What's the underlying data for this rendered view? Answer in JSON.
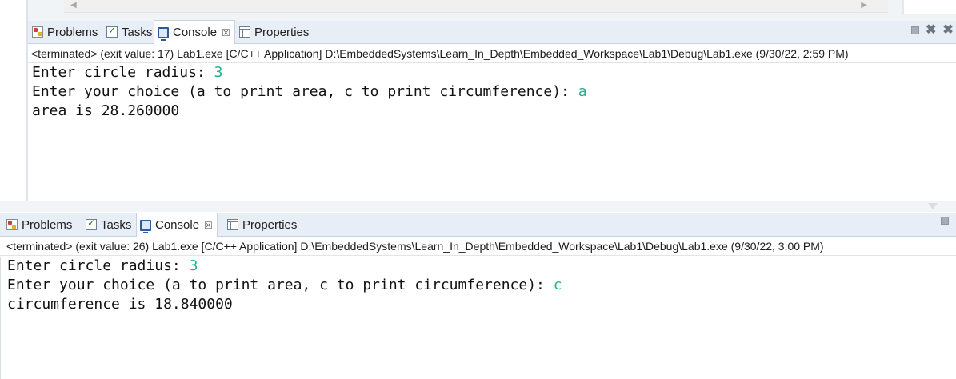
{
  "top_console": {
    "tabs": [
      {
        "label": "Problems",
        "icon": "problems-icon"
      },
      {
        "label": "Tasks",
        "icon": "tasks-icon"
      },
      {
        "label": "Console",
        "icon": "console-icon",
        "active": true
      },
      {
        "label": "Properties",
        "icon": "properties-icon"
      }
    ],
    "status": "<terminated> (exit value: 17) Lab1.exe [C/C++ Application] D:\\EmbeddedSystems\\Learn_In_Depth\\Embedded_Workspace\\Lab1\\Debug\\Lab1.exe (9/30/22, 2:59 PM)",
    "lines": [
      {
        "text": "Enter circle radius: ",
        "input": "3"
      },
      {
        "text": "Enter your choice (a to print area, c to print circumference): ",
        "input": "a"
      },
      {
        "text": "area is 28.260000",
        "input": ""
      }
    ]
  },
  "bottom_console": {
    "tabs": [
      {
        "label": "Problems",
        "icon": "problems-icon"
      },
      {
        "label": "Tasks",
        "icon": "tasks-icon"
      },
      {
        "label": "Console",
        "icon": "console-icon",
        "active": true
      },
      {
        "label": "Properties",
        "icon": "properties-icon"
      }
    ],
    "status": "<terminated> (exit value: 26) Lab1.exe [C/C++ Application] D:\\EmbeddedSystems\\Learn_In_Depth\\Embedded_Workspace\\Lab1\\Debug\\Lab1.exe (9/30/22, 3:00 PM)",
    "lines": [
      {
        "text": "Enter circle radius: ",
        "input": "3"
      },
      {
        "text": "Enter your choice (a to print area, c to print circumference): ",
        "input": "c"
      },
      {
        "text": "circumference is 18.840000",
        "input": ""
      }
    ]
  },
  "colors": {
    "user_input": "#23b28f",
    "tab_bar": "#e8eef5"
  }
}
